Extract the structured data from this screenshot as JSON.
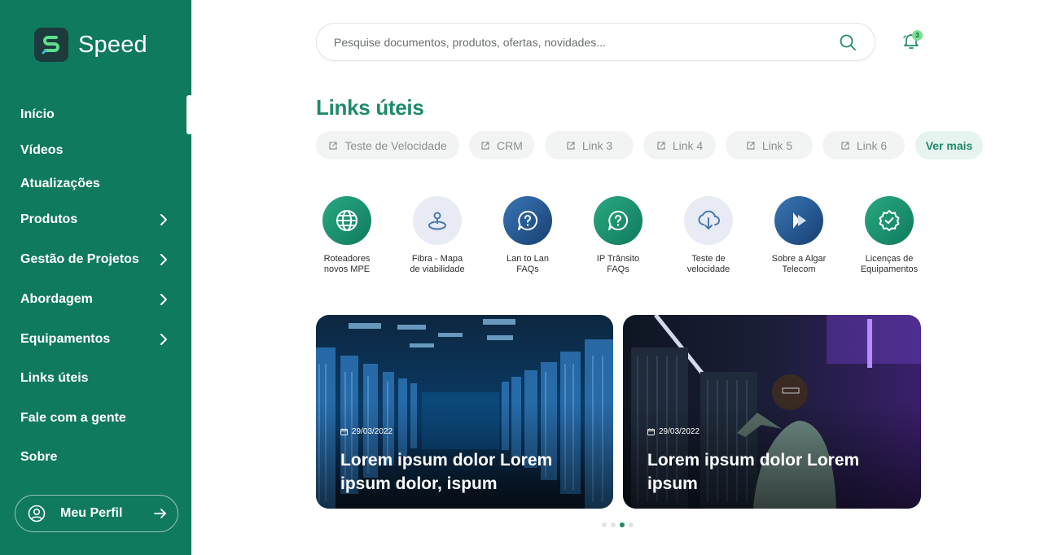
{
  "brand": {
    "name": "Speed"
  },
  "sidebar": {
    "items": [
      {
        "label": "Início",
        "active": true,
        "has_submenu": false
      },
      {
        "label": "Vídeos",
        "has_submenu": false
      },
      {
        "label": "Atualizações",
        "has_submenu": false
      },
      {
        "label": "Produtos",
        "has_submenu": true
      },
      {
        "label": "Gestão de Projetos",
        "has_submenu": true
      },
      {
        "label": "Abordagem",
        "has_submenu": true
      },
      {
        "label": "Equipamentos",
        "has_submenu": true
      },
      {
        "label": "Links úteis",
        "has_submenu": false
      },
      {
        "label": "Fale com a gente",
        "has_submenu": false
      },
      {
        "label": "Sobre",
        "has_submenu": false
      }
    ],
    "profile": {
      "label": "Meu Perfil"
    }
  },
  "header": {
    "search": {
      "placeholder": "Pesquise documentos, produtos, ofertas, novidades..."
    },
    "notifications": {
      "count": "3"
    }
  },
  "links": {
    "title": "Links úteis",
    "chips": [
      "Teste de Velocidade",
      "CRM",
      "Link 3",
      "Link 4",
      "Link 5",
      "Link 6"
    ],
    "more_label": "Ver mais"
  },
  "quick_access": [
    {
      "icon": "globe-icon",
      "line1": "Roteadores",
      "line2": "novos MPE"
    },
    {
      "icon": "map-pin-icon",
      "line1": "Fibra - Mapa",
      "line2": "de viabilidade"
    },
    {
      "icon": "help-chat-icon",
      "line1": "Lan to Lan",
      "line2": "FAQs"
    },
    {
      "icon": "help-chat-icon",
      "line1": "IP Trânsito",
      "line2": "FAQs"
    },
    {
      "icon": "cloud-download-icon",
      "line1": "Teste de",
      "line2": "velocidade"
    },
    {
      "icon": "play-logo-icon",
      "line1": "Sobre a Algar",
      "line2": "Telecom"
    },
    {
      "icon": "verified-badge-icon",
      "line1": "Licenças de",
      "line2": "Equipamentos"
    }
  ],
  "news": [
    {
      "date": "29/03/2022",
      "title": "Lorem ipsum dolor Lorem ipsum dolor, ispum"
    },
    {
      "date": "29/03/2022",
      "title": "Lorem ipsum dolor Lorem ipsum"
    }
  ],
  "carousel": {
    "pages": 4,
    "active_page": 3
  },
  "colors": {
    "primary": "#0f7a5e",
    "accent_text": "#1e8a6a",
    "chip_bg": "#f2f4f3",
    "badge": "#7ee08e"
  }
}
